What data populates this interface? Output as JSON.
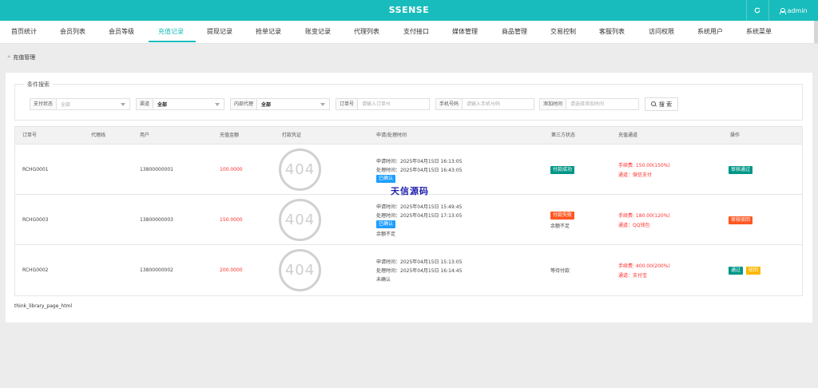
{
  "app": {
    "title": "SSENSE",
    "user": "admin"
  },
  "nav": {
    "items": [
      {
        "label": "首页统计"
      },
      {
        "label": "会员列表"
      },
      {
        "label": "会员等级"
      },
      {
        "label": "充值记录",
        "active": true
      },
      {
        "label": "提现记录"
      },
      {
        "label": "抢单记录"
      },
      {
        "label": "账变记录"
      },
      {
        "label": "代理列表"
      },
      {
        "label": "支付接口"
      },
      {
        "label": "媒体管理"
      },
      {
        "label": "商品管理"
      },
      {
        "label": "交易控制"
      },
      {
        "label": "客服列表"
      },
      {
        "label": "访问权限"
      },
      {
        "label": "系统用户"
      },
      {
        "label": "系统菜单"
      }
    ]
  },
  "breadcrumb": {
    "separator": "»",
    "current": "充值管理"
  },
  "filter": {
    "legend": "条件搜索",
    "pay_status": {
      "label": "支付状态",
      "value": "全部"
    },
    "channel": {
      "label": "渠道",
      "value": "全部"
    },
    "agent": {
      "label": "内部代理",
      "value": "全部"
    },
    "order_no": {
      "label": "订单号",
      "placeholder": "请输入订单号"
    },
    "phone": {
      "label": "手机号码",
      "placeholder": "请输入手机号码"
    },
    "add_time": {
      "label": "添加时间",
      "placeholder": "请选择添加时间"
    },
    "search_label": "搜 索"
  },
  "table": {
    "headers": [
      "订单号",
      "代理线",
      "用户",
      "充值金额",
      "打款凭证",
      "申请/处理时间",
      "第三方状态",
      "充值通道",
      "操作"
    ],
    "rows": [
      {
        "order": "RCHG0001",
        "agent": "",
        "user": "13800000001",
        "amount": "100.0000",
        "image": "404",
        "apply_time": "申请时间：2025年04月15日 16:13:05",
        "process_time": "处理时间：2025年04月15日 16:43:05",
        "confirm": "已确认",
        "note": "",
        "status_badge": "付款成功",
        "status_text": "",
        "fee": "手续费: 150.00(150%)",
        "channel": "通道：微信支付",
        "ops": [
          "审核通过"
        ]
      },
      {
        "order": "RCHG0003",
        "agent": "",
        "user": "13800000003",
        "amount": "150.0000",
        "image": "404",
        "apply_time": "申请时间：2025年04月15日 15:49:45",
        "process_time": "处理时间：2025年04月15日 17:13:05",
        "confirm": "已确认",
        "note": "余额不足",
        "status_badge": "付款失败",
        "status_text": "余额不足",
        "fee": "手续费: 180.00(120%)",
        "channel": "通道：QQ钱包",
        "ops": [
          "审核驳回"
        ]
      },
      {
        "order": "RCHG0002",
        "agent": "",
        "user": "13800000002",
        "amount": "200.0000",
        "image": "404",
        "apply_time": "申请时间：2025年04月15日 15:13:05",
        "process_time": "处理时间：2025年04月15日 16:14:45",
        "confirm": "",
        "note": "未确认",
        "status_badge": "",
        "status_text": "等待付款",
        "fee": "手续费: 400.00(200%)",
        "channel": "通道：支付宝",
        "ops": [
          "通过",
          "驳回"
        ]
      }
    ]
  },
  "watermark": "天信源码",
  "pager": "think_library_page_html",
  "colors": {
    "primary": "#19bcbc",
    "teal": "#009688",
    "red": "#ff5722",
    "blue": "#1e9fff",
    "orange": "#ffb800",
    "amount_red": "#ff3030"
  }
}
